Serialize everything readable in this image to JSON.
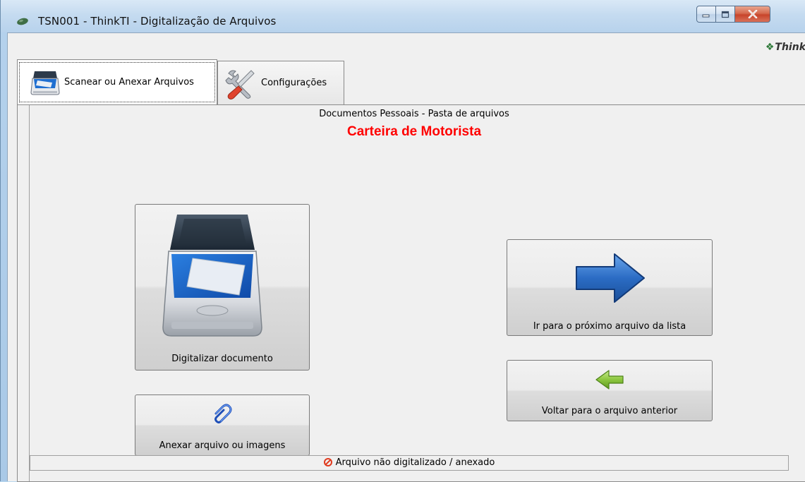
{
  "window": {
    "title": "TSN001 - ThinkTI - Digitalização de Arquivos",
    "brand": "Think",
    "controls": {
      "minimize": "minimize-icon",
      "maximize": "maximize-icon",
      "close": "close-icon"
    }
  },
  "tabs": [
    {
      "label": "Scanear ou Anexar Arquivos",
      "icon": "scanner-icon",
      "active": true
    },
    {
      "label": "Configurações",
      "icon": "tools-icon",
      "active": false
    }
  ],
  "main": {
    "subtitle": "Documentos Pessoais - Pasta de arquivos",
    "document_title": "Carteira de Motorista",
    "buttons": {
      "scan": "Digitalizar documento",
      "attach": "Anexar arquivo ou imagens",
      "next": "Ir para o próximo arquivo da lista",
      "previous": "Voltar para o arquivo anterior"
    },
    "status": "Arquivo não digitalizado / anexado"
  },
  "colors": {
    "document_title": "#ff0000",
    "next_arrow": "#2b6cc4",
    "previous_arrow": "#8cc63f",
    "status_icon": "#e03a1e"
  }
}
